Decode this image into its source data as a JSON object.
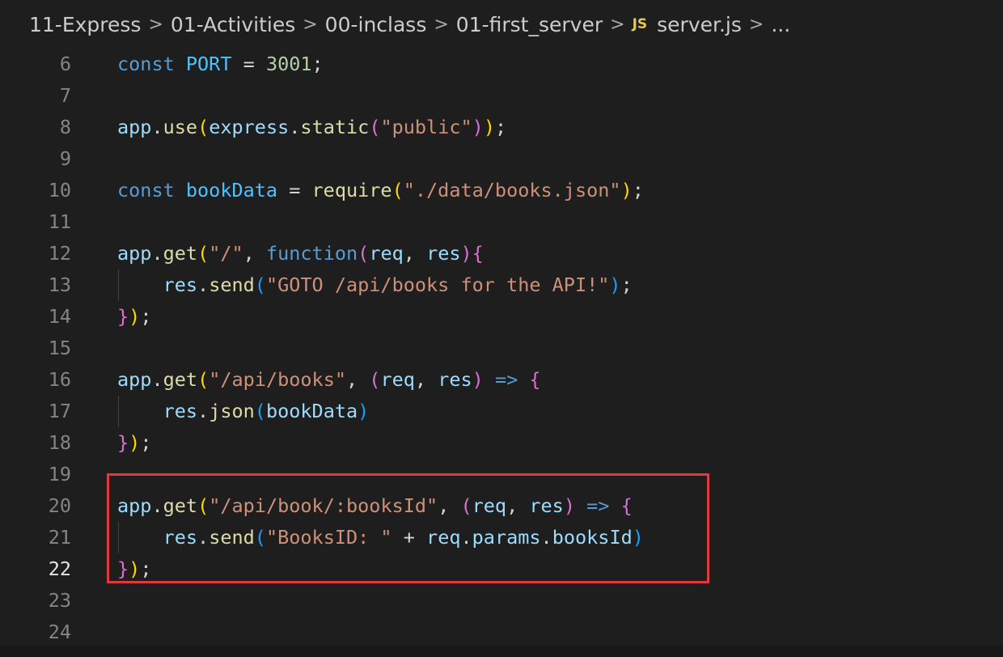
{
  "breadcrumb": {
    "items": [
      "11-Express",
      "01-Activities",
      "00-inclass",
      "01-first_server"
    ],
    "separator": ">",
    "file_icon": "JS",
    "file_name": "server.js",
    "more": "..."
  },
  "editor": {
    "active_line": "22",
    "highlight_color": "#e0393e",
    "lines": [
      {
        "n": "6",
        "tokens": [
          [
            "kw",
            "const "
          ],
          [
            "const",
            "PORT"
          ],
          [
            "op",
            " = "
          ],
          [
            "num",
            "3001"
          ],
          [
            "op",
            ";"
          ]
        ]
      },
      {
        "n": "7",
        "tokens": []
      },
      {
        "n": "8",
        "tokens": [
          [
            "var",
            "app"
          ],
          [
            "op",
            "."
          ],
          [
            "fn",
            "use"
          ],
          [
            "p1",
            "("
          ],
          [
            "var",
            "express"
          ],
          [
            "op",
            "."
          ],
          [
            "fn",
            "static"
          ],
          [
            "p2",
            "("
          ],
          [
            "str",
            "\"public\""
          ],
          [
            "p2",
            ")"
          ],
          [
            "p1",
            ")"
          ],
          [
            "op",
            ";"
          ]
        ]
      },
      {
        "n": "9",
        "tokens": []
      },
      {
        "n": "10",
        "tokens": [
          [
            "kw",
            "const "
          ],
          [
            "const",
            "bookData"
          ],
          [
            "op",
            " = "
          ],
          [
            "fn",
            "require"
          ],
          [
            "p1",
            "("
          ],
          [
            "str",
            "\"./data/books.json\""
          ],
          [
            "p1",
            ")"
          ],
          [
            "op",
            ";"
          ]
        ]
      },
      {
        "n": "11",
        "tokens": []
      },
      {
        "n": "12",
        "tokens": [
          [
            "var",
            "app"
          ],
          [
            "op",
            "."
          ],
          [
            "fn",
            "get"
          ],
          [
            "p1",
            "("
          ],
          [
            "str",
            "\"/\""
          ],
          [
            "op",
            ", "
          ],
          [
            "kw",
            "function"
          ],
          [
            "p2",
            "("
          ],
          [
            "var",
            "req"
          ],
          [
            "op",
            ", "
          ],
          [
            "var",
            "res"
          ],
          [
            "p2",
            ")"
          ],
          [
            "p2",
            "{"
          ]
        ]
      },
      {
        "n": "13",
        "guide": true,
        "tokens": [
          [
            "op",
            "    "
          ],
          [
            "var",
            "res"
          ],
          [
            "op",
            "."
          ],
          [
            "fn",
            "send"
          ],
          [
            "p3",
            "("
          ],
          [
            "str",
            "\"GOTO /api/books for the API!\""
          ],
          [
            "p3",
            ")"
          ],
          [
            "op",
            ";"
          ]
        ]
      },
      {
        "n": "14",
        "tokens": [
          [
            "p2",
            "}"
          ],
          [
            "p1",
            ")"
          ],
          [
            "op",
            ";"
          ]
        ]
      },
      {
        "n": "15",
        "tokens": []
      },
      {
        "n": "16",
        "tokens": [
          [
            "var",
            "app"
          ],
          [
            "op",
            "."
          ],
          [
            "fn",
            "get"
          ],
          [
            "p1",
            "("
          ],
          [
            "str",
            "\"/api/books\""
          ],
          [
            "op",
            ", "
          ],
          [
            "p2",
            "("
          ],
          [
            "var",
            "req"
          ],
          [
            "op",
            ", "
          ],
          [
            "var",
            "res"
          ],
          [
            "p2",
            ")"
          ],
          [
            "kw",
            " => "
          ],
          [
            "p2",
            "{"
          ]
        ]
      },
      {
        "n": "17",
        "guide": true,
        "tokens": [
          [
            "op",
            "    "
          ],
          [
            "var",
            "res"
          ],
          [
            "op",
            "."
          ],
          [
            "fn",
            "json"
          ],
          [
            "p3",
            "("
          ],
          [
            "var",
            "bookData"
          ],
          [
            "p3",
            ")"
          ]
        ]
      },
      {
        "n": "18",
        "tokens": [
          [
            "p2",
            "}"
          ],
          [
            "p1",
            ")"
          ],
          [
            "op",
            ";"
          ]
        ]
      },
      {
        "n": "19",
        "tokens": []
      },
      {
        "n": "20",
        "tokens": [
          [
            "var",
            "app"
          ],
          [
            "op",
            "."
          ],
          [
            "fn",
            "get"
          ],
          [
            "p1",
            "("
          ],
          [
            "str",
            "\"/api/book/:booksId\""
          ],
          [
            "op",
            ", "
          ],
          [
            "p2",
            "("
          ],
          [
            "var",
            "req"
          ],
          [
            "op",
            ", "
          ],
          [
            "var",
            "res"
          ],
          [
            "p2",
            ")"
          ],
          [
            "kw",
            " => "
          ],
          [
            "p2",
            "{"
          ]
        ]
      },
      {
        "n": "21",
        "guide": true,
        "tokens": [
          [
            "op",
            "    "
          ],
          [
            "var",
            "res"
          ],
          [
            "op",
            "."
          ],
          [
            "fn",
            "send"
          ],
          [
            "p3",
            "("
          ],
          [
            "str",
            "\"BooksID: \""
          ],
          [
            "op",
            " + "
          ],
          [
            "var",
            "req"
          ],
          [
            "op",
            "."
          ],
          [
            "var",
            "params"
          ],
          [
            "op",
            "."
          ],
          [
            "var",
            "booksId"
          ],
          [
            "p3",
            ")"
          ]
        ]
      },
      {
        "n": "22",
        "tokens": [
          [
            "p2",
            "}"
          ],
          [
            "p1",
            ")"
          ],
          [
            "op",
            ";"
          ]
        ]
      },
      {
        "n": "23",
        "tokens": []
      },
      {
        "n": "24",
        "tokens": []
      }
    ]
  }
}
